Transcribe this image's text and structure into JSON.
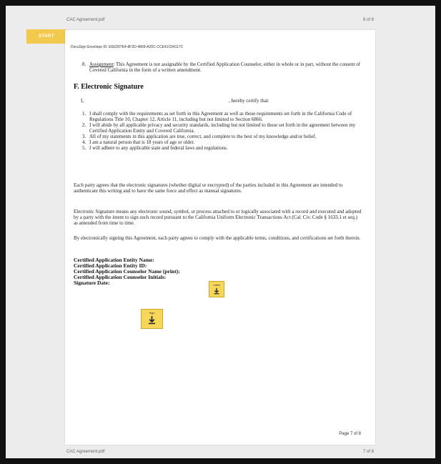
{
  "header": {
    "filename": "CAC Agreement.pdf",
    "page_count": "6 of 8"
  },
  "footer": {
    "filename": "CAC Agreement.pdf",
    "page_count": "7 of 8"
  },
  "start_button": {
    "label": "START"
  },
  "document": {
    "envelope_id": "DocuSign Envelope ID: E6ED07E4-8F2D-4869-A20C-CCE41C64117C",
    "assignment": {
      "number": "8.",
      "title": "Assignment",
      "text": ": This Agreement is not assignable by the Certified Application Counselor, either in whole or in part, without the consent of Covered California in the form of a written amendment."
    },
    "section_title": "F. Electronic Signature",
    "certify_prefix": "I,",
    "certify_suffix": ", hereby certify that:",
    "items": [
      {
        "n": "1.",
        "text": "I shall comply with the requirements as set forth in this Agreement as well as those requirements set forth in the California Code of Regulations Title 10, Chapter 12, Article 11, including but not limited to Section 6866."
      },
      {
        "n": "2.",
        "text": "I will abide by all applicable privacy and security standards, including but not limited to those set forth in the agreement between my Certified Application Entity and Covered California."
      },
      {
        "n": "3.",
        "text": "All of my statements in this application are true, correct, and complete to the best of my knowledge and/or belief."
      },
      {
        "n": "4.",
        "text": "I am a natural person that is 18 years of age or older."
      },
      {
        "n": "5.",
        "text": "I will adhere to any applicable state and federal laws and regulations."
      }
    ],
    "para1": "Each party agrees that the electronic signatures (whether digital or encrypted) of the parties included in this Agreement are intended to authenticate this writing and to have the same force and effect as manual signatures.",
    "para2": "Electronic Signature means any electronic sound, symbol, or process attached to or logically associated with a record and executed and adopted by a party with the intent to sign such record pursuant to the California Uniform Electronic Transactions Act (Cal. Civ. Code § 1633.1 et seq.) as amended from time to time.",
    "para3": "By electronically signing this Agreement, each party agrees to comply with the applicable terms, conditions, and certifications set forth therein.",
    "labels": {
      "entity_name": "Certified Application Entity Name:",
      "entity_id": "Certified Application Entity ID:",
      "counselor_name": "Certified Application Counselor Name (print):",
      "counselor_initials": "Certified Application Counselor Initials:",
      "signature_date": "Signature Date:"
    },
    "initial_tag": "Initial",
    "sign_tag": "Sign",
    "page_number": "Page 7 of 8"
  }
}
